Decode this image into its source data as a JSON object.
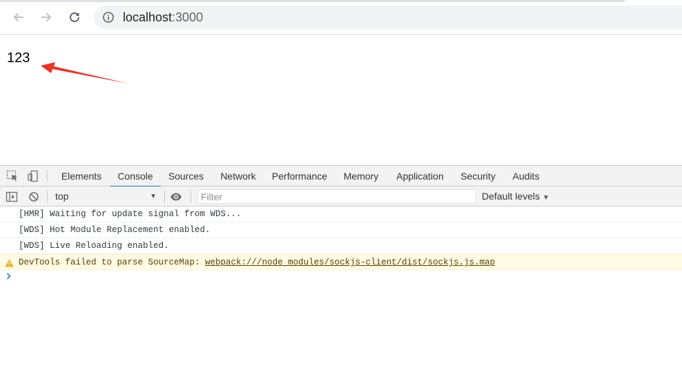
{
  "browser": {
    "url_host": "localhost",
    "url_port": ":3000",
    "icons": {
      "back": "arrow-left-icon",
      "forward": "arrow-right-icon",
      "reload": "reload-icon",
      "info": "info-circle-icon"
    }
  },
  "page": {
    "content": "123",
    "annotation": "red-arrow-pointing-left"
  },
  "devtools": {
    "tabs": [
      {
        "label": "Elements",
        "active": false
      },
      {
        "label": "Console",
        "active": true
      },
      {
        "label": "Sources",
        "active": false
      },
      {
        "label": "Network",
        "active": false
      },
      {
        "label": "Performance",
        "active": false
      },
      {
        "label": "Memory",
        "active": false
      },
      {
        "label": "Application",
        "active": false
      },
      {
        "label": "Security",
        "active": false
      },
      {
        "label": "Audits",
        "active": false
      }
    ],
    "console_toolbar": {
      "context": "top",
      "filter_placeholder": "Filter",
      "levels": "Default levels"
    },
    "messages": [
      {
        "level": "log",
        "text": "[HMR] Waiting for update signal from WDS..."
      },
      {
        "level": "log",
        "text": "[WDS] Hot Module Replacement enabled."
      },
      {
        "level": "log",
        "text": "[WDS] Live Reloading enabled."
      },
      {
        "level": "warning",
        "text": "DevTools failed to parse SourceMap: ",
        "link": "webpack:///node_modules/sockjs-client/dist/sockjs.js.map"
      }
    ],
    "colors": {
      "active_tab_underline": "#1a73e8",
      "warning_bg": "#fffbe5",
      "warning_icon": "#f0a91b",
      "prompt": "#1a73e8"
    }
  }
}
